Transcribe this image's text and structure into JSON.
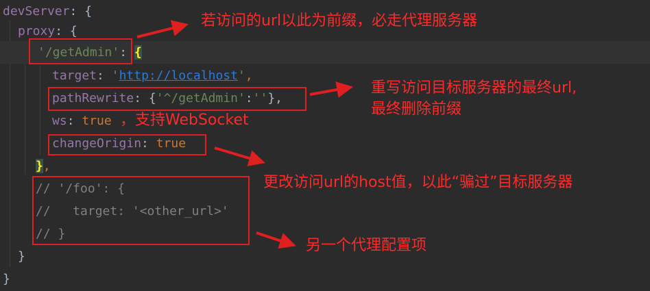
{
  "code": {
    "l1_key": "devServer",
    "l1_sep": ": {",
    "l2_key": "proxy",
    "l2_sep": ": {",
    "l3_key": "'/getAdmin'",
    "l3_colon": ":",
    "l3_brace": "{",
    "l4_key": "target",
    "l4_colon": ": ",
    "l4_q1": "'",
    "l4_url": "http://localhost",
    "l4_q2": "'",
    "l4_comma": ",",
    "l5_key": "pathRewrite",
    "l5_open": ": {",
    "l5_pattern": "'^/getAdmin'",
    "l5_colon": ":",
    "l5_empty": "''",
    "l5_close": "},",
    "l6_key": "ws",
    "l6_colon": ": ",
    "l6_val": "true",
    "l7_key": "changeOrigin",
    "l7_colon": ": ",
    "l7_val": "true",
    "l8_close": "}",
    "l8_comma": ",",
    "l9_comment": "// '/foo': {",
    "l10_comment": "//   target: '<other_url>'",
    "l11_comment": "// }",
    "l12_close": "}",
    "l13_close": "}"
  },
  "annotations": {
    "prefix": "若访问的url以此为前缀，必走代理服务器",
    "rewrite_line1": "重写访问目标服务器的最终url,",
    "rewrite_line2": "最终删除前缀",
    "ws": "，支持WebSocket",
    "change_origin": "更改访问url的host值，以此“骗过”目标服务器",
    "other_proxy": "另一个代理配置项"
  },
  "colors": {
    "background": "#2b2b2b",
    "keyword": "#cc7832",
    "property": "#9876aa",
    "string": "#6a8759",
    "comment": "#808080",
    "annotation": "#e02020"
  }
}
